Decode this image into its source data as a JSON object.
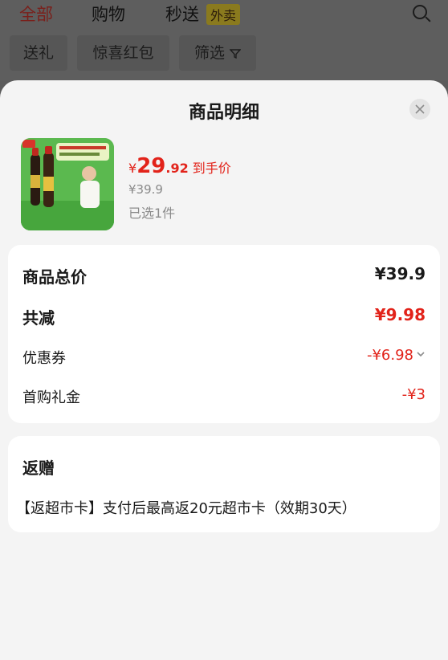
{
  "background": {
    "tabs": [
      {
        "label": "全部"
      },
      {
        "label": "购物"
      },
      {
        "label": "秒送"
      }
    ],
    "badge": "外卖",
    "filters": [
      {
        "label": "送礼"
      },
      {
        "label": "惊喜红包"
      },
      {
        "label": "筛选"
      }
    ]
  },
  "sheet": {
    "title": "商品明细",
    "product": {
      "price_symbol": "¥",
      "price_int": "29",
      "price_dec": ".92",
      "price_suffix": "到手价",
      "original_price": "¥39.9",
      "selected_count": "已选1件"
    },
    "summary": [
      {
        "label": "商品总价",
        "value": "¥39.9"
      },
      {
        "label": "共减",
        "value": "¥9.98"
      },
      {
        "label": "优惠券",
        "value": "-¥6.98"
      },
      {
        "label": "首购礼金",
        "value": "-¥3"
      }
    ],
    "rebate": {
      "title": "返赠",
      "text": "【返超市卡】支付后最高返20元超市卡（效期30天）"
    }
  },
  "colors": {
    "accent_red": "#e2231a",
    "sheet_bg": "#f4f4f4",
    "card_bg": "#ffffff",
    "product_green": "#57b84c"
  }
}
